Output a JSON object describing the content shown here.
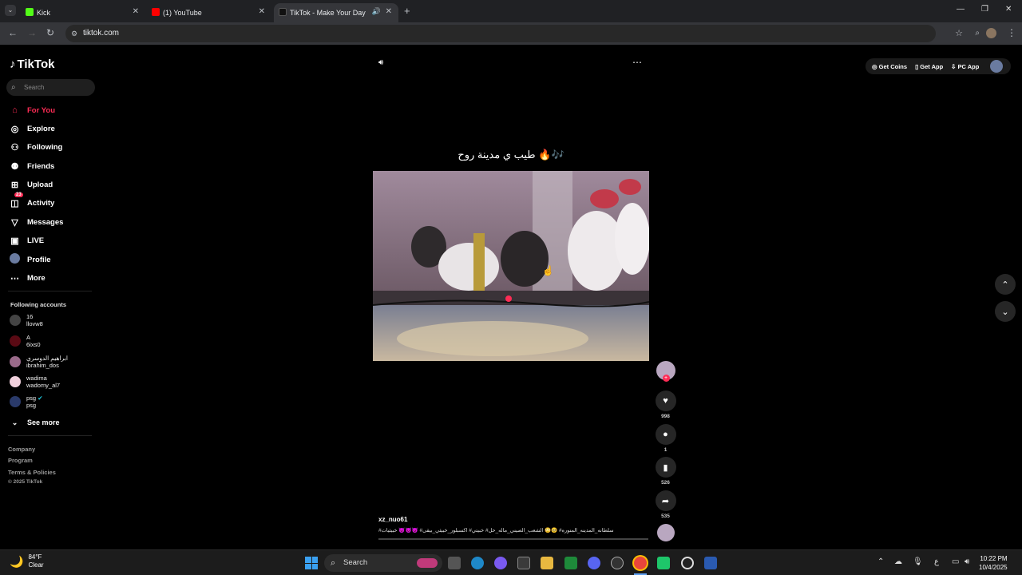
{
  "browser": {
    "tabs": [
      {
        "title": "Kick",
        "active": false
      },
      {
        "title": "(1) YouTube",
        "active": false
      },
      {
        "title": "TikTok - Make Your Day",
        "active": true
      }
    ],
    "url": "tiktok.com"
  },
  "sidebar": {
    "logo": "TikTok",
    "search_placeholder": "Search",
    "nav": [
      {
        "label": "For You",
        "icon": "home-icon"
      },
      {
        "label": "Explore",
        "icon": "compass-icon"
      },
      {
        "label": "Following",
        "icon": "following-icon"
      },
      {
        "label": "Friends",
        "icon": "friends-icon"
      },
      {
        "label": "Upload",
        "icon": "upload-icon"
      },
      {
        "label": "Activity",
        "icon": "activity-icon",
        "badge": "23"
      },
      {
        "label": "Messages",
        "icon": "messages-icon"
      },
      {
        "label": "LIVE",
        "icon": "live-icon"
      },
      {
        "label": "Profile",
        "icon": "profile-icon"
      },
      {
        "label": "More",
        "icon": "more-icon"
      }
    ],
    "following_heading": "Following accounts",
    "accounts": [
      {
        "name": "16",
        "handle": "llovw8"
      },
      {
        "name": "A",
        "handle": "6ixs0"
      },
      {
        "name": "ابراهيم الدوسري",
        "handle": "ibrahim_dos"
      },
      {
        "name": "wadima",
        "handle": "wadomy_al7"
      },
      {
        "name": "psg",
        "handle": "psg"
      }
    ],
    "see_more": "See more",
    "footer": [
      "Company",
      "Program",
      "Terms & Policies",
      "© 2025 TikTok"
    ]
  },
  "header": {
    "get_coins": "Get Coins",
    "get_app": "Get App",
    "pc_app": "PC App"
  },
  "video": {
    "caption": "طيب ي مدينة روح 🔥🎶",
    "author": "xz_nuo61",
    "hashtags": "سلطانه_المدينه_المنوره# 🥺😳 الشعب_الصيني_ماله_حل# خبيتي# اكسبلور_خبيثي_بيقى# 👿👿👿 خبيثيات#",
    "likes": "998",
    "comments": "1",
    "saves": "526",
    "shares": "535"
  },
  "taskbar": {
    "weather_temp": "84°F",
    "weather_desc": "Clear",
    "search": "Search",
    "time": "10:22 PM",
    "date": "10/4/2025",
    "lang": "ع"
  },
  "colors": {
    "accent": "#fe2c55",
    "background": "#000000",
    "chrome_dark": "#202124"
  }
}
